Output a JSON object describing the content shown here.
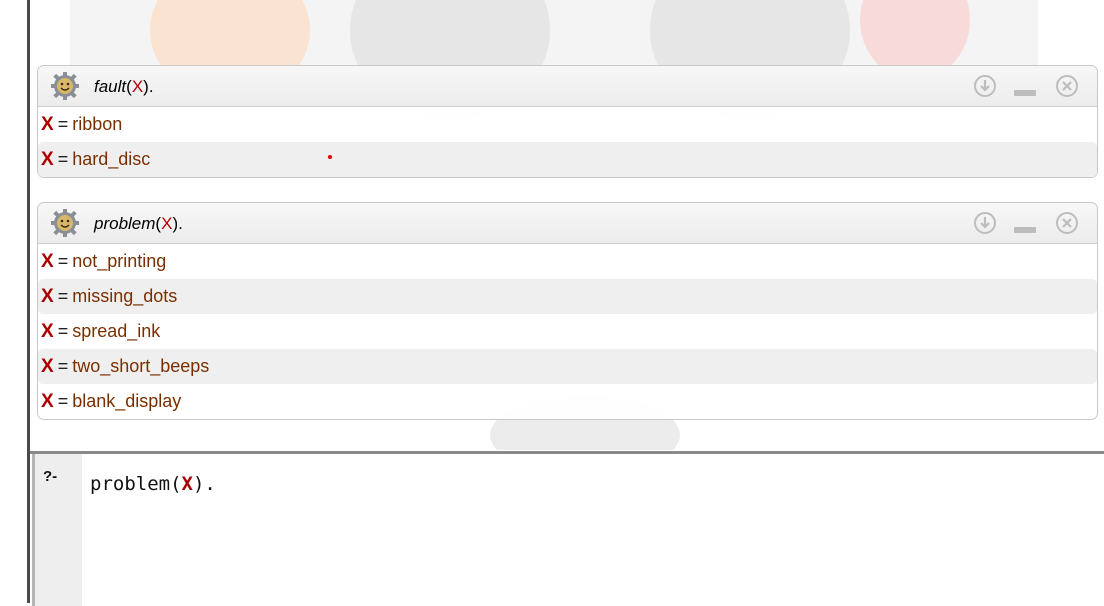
{
  "runners": [
    {
      "query_name": "fault",
      "query_var": "X",
      "query_tail": ").",
      "answers": [
        {
          "var": "X",
          "eq": "=",
          "value": "ribbon"
        },
        {
          "var": "X",
          "eq": "=",
          "value": "hard_disc"
        }
      ]
    },
    {
      "query_name": "problem",
      "query_var": "X",
      "query_tail": ").",
      "answers": [
        {
          "var": "X",
          "eq": "=",
          "value": "not_printing"
        },
        {
          "var": "X",
          "eq": "=",
          "value": "missing_dots"
        },
        {
          "var": "X",
          "eq": "=",
          "value": "spread_ink"
        },
        {
          "var": "X",
          "eq": "=",
          "value": "two_short_beeps"
        },
        {
          "var": "X",
          "eq": "=",
          "value": "blank_display"
        }
      ]
    }
  ],
  "editor": {
    "prompt": "?-",
    "query_name": "problem(",
    "query_var": "X",
    "query_tail": ")."
  },
  "icons": {
    "runner_icon": "gear-smiley-icon",
    "download": "download-icon",
    "minimize": "minimize-icon",
    "close": "close-icon"
  },
  "colors": {
    "variable": "#a80000",
    "value": "#7a2f00",
    "control": "#bdbdbd"
  }
}
